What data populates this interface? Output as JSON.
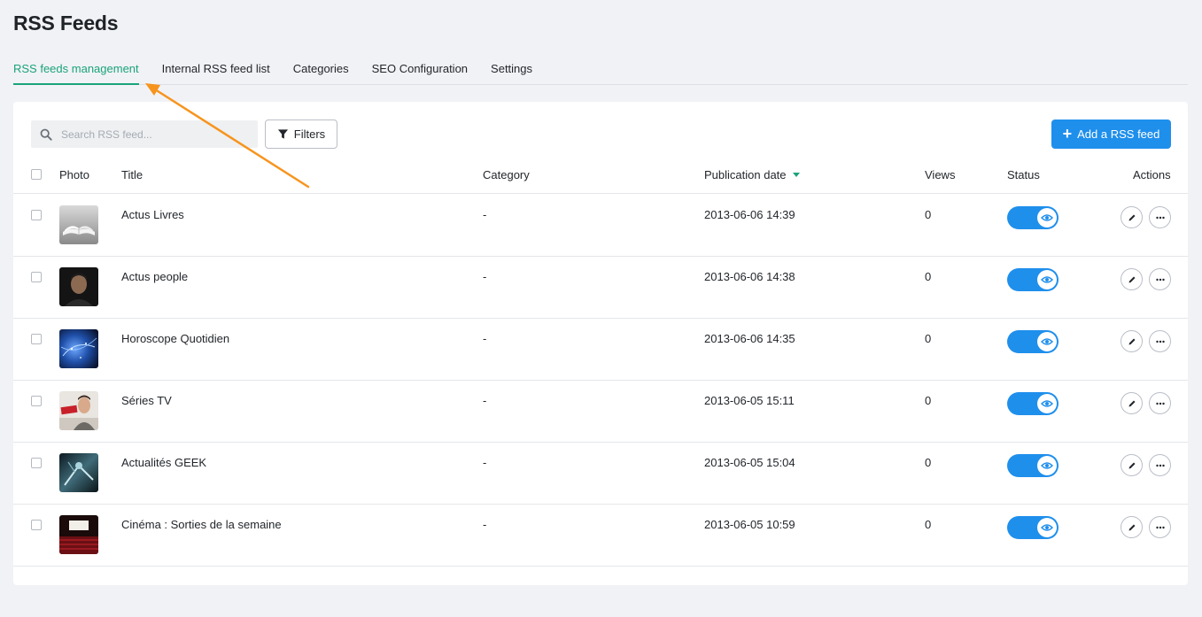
{
  "page": {
    "title": "RSS Feeds"
  },
  "tabs": [
    {
      "label": "RSS feeds management",
      "active": true
    },
    {
      "label": "Internal RSS feed list",
      "active": false
    },
    {
      "label": "Categories",
      "active": false
    },
    {
      "label": "SEO Configuration",
      "active": false
    },
    {
      "label": "Settings",
      "active": false
    }
  ],
  "toolbar": {
    "search_placeholder": "Search RSS feed...",
    "search_value": "",
    "filters_label": "Filters",
    "add_label": "Add a RSS feed"
  },
  "table": {
    "columns": {
      "photo": "Photo",
      "title": "Title",
      "category": "Category",
      "publication_date": "Publication date",
      "views": "Views",
      "status": "Status",
      "actions": "Actions"
    },
    "sort": {
      "column": "publication_date",
      "direction": "desc"
    },
    "rows": [
      {
        "title": "Actus Livres",
        "category": "-",
        "date": "2013-06-06 14:39",
        "views": "0",
        "status_on": true,
        "thumb_icon": "book-photo"
      },
      {
        "title": "Actus people",
        "category": "-",
        "date": "2013-06-06 14:38",
        "views": "0",
        "status_on": true,
        "thumb_icon": "person-photo"
      },
      {
        "title": "Horoscope Quotidien",
        "category": "-",
        "date": "2013-06-06 14:35",
        "views": "0",
        "status_on": true,
        "thumb_icon": "galaxy-photo"
      },
      {
        "title": "Séries TV",
        "category": "-",
        "date": "2013-06-05 15:11",
        "views": "0",
        "status_on": true,
        "thumb_icon": "tv-show-photo"
      },
      {
        "title": "Actualités GEEK",
        "category": "-",
        "date": "2013-06-05 15:04",
        "views": "0",
        "status_on": true,
        "thumb_icon": "robot-photo"
      },
      {
        "title": "Cinéma : Sorties de la semaine",
        "category": "-",
        "date": "2013-06-05 10:59",
        "views": "0",
        "status_on": true,
        "thumb_icon": "cinema-photo"
      }
    ]
  },
  "colors": {
    "accent_green": "#1aa37a",
    "primary_blue": "#1f8fec",
    "annotation_arrow": "#f7941d",
    "background": "#f1f2f6"
  },
  "icons": {
    "search": "search-icon",
    "filter": "filter-icon",
    "add": "plus-icon",
    "status": "eye-icon",
    "edit": "pencil-icon",
    "more": "more-icon"
  }
}
